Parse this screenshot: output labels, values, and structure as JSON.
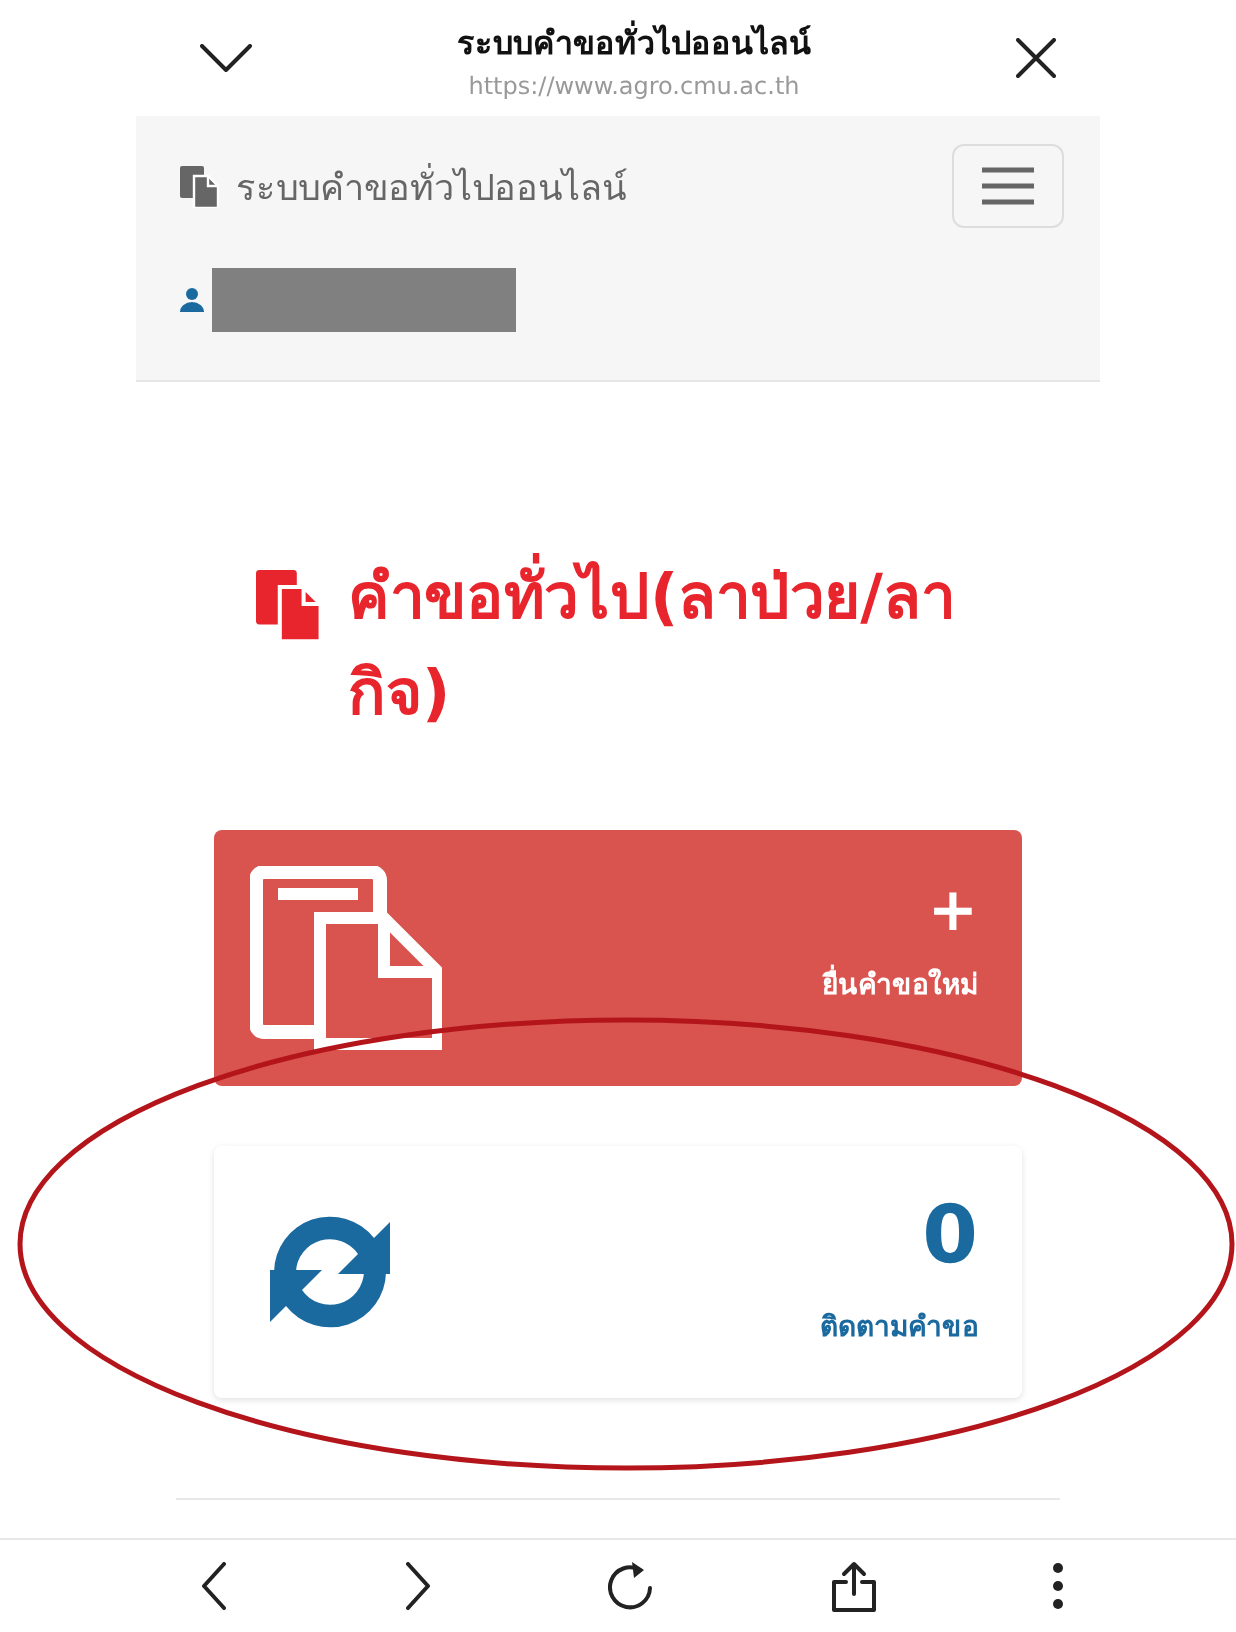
{
  "browser_bar": {
    "title": "ระบบคำขอทั่วไปออนไลน์",
    "url": "https://www.agro.cmu.ac.th"
  },
  "navbar": {
    "brand": "ระบบคำขอทั่วไปออนไลน์"
  },
  "page_heading": "คำขอทั่วไป(ลาป่วย/ลากิจ)",
  "cards": [
    {
      "kind": "action",
      "value": "+",
      "label": "ยื่นคำขอใหม่"
    },
    {
      "kind": "tracker",
      "value": "0",
      "label": "ติดตามคำขอ"
    }
  ]
}
